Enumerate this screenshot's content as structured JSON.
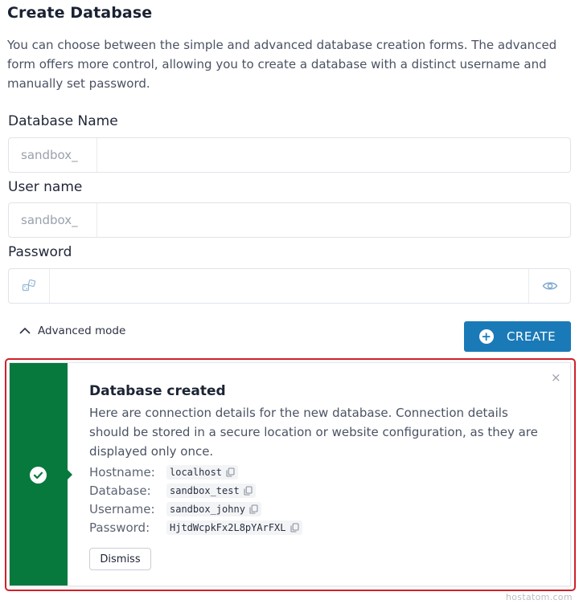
{
  "page": {
    "title": "Create Database",
    "intro": "You can choose between the simple and advanced database creation forms. The advanced form offers more control, allowing you to create a database with a distinct username and manually set password."
  },
  "form": {
    "database_name": {
      "label": "Database Name",
      "prefix": "sandbox_",
      "value": ""
    },
    "user_name": {
      "label": "User name",
      "prefix": "sandbox_",
      "value": ""
    },
    "password": {
      "label": "Password",
      "value": "",
      "generate_icon": "dice-icon",
      "toggle_icon": "eye-icon"
    },
    "advanced_toggle": {
      "label": "Advanced mode",
      "icon": "chevron-up-icon"
    },
    "create_button": {
      "label": "CREATE",
      "icon": "plus-circle-icon",
      "color": "#1a7ab8"
    }
  },
  "alert": {
    "title": "Database created",
    "message": "Here are connection details for the new database. Connection details should be stored in a secure location or website configuration, as they are displayed only once.",
    "accent_color": "#07793d",
    "outline_color": "#d0202a",
    "details": [
      {
        "label": "Hostname:",
        "value": "localhost"
      },
      {
        "label": "Database:",
        "value": "sandbox_test"
      },
      {
        "label": "Username:",
        "value": "sandbox_johny"
      },
      {
        "label": "Password:",
        "value": "HjtdWcpkFx2L8pYArFXL"
      }
    ],
    "dismiss_label": "Dismiss",
    "close_glyph": "×"
  },
  "watermark": "hostatom.com"
}
